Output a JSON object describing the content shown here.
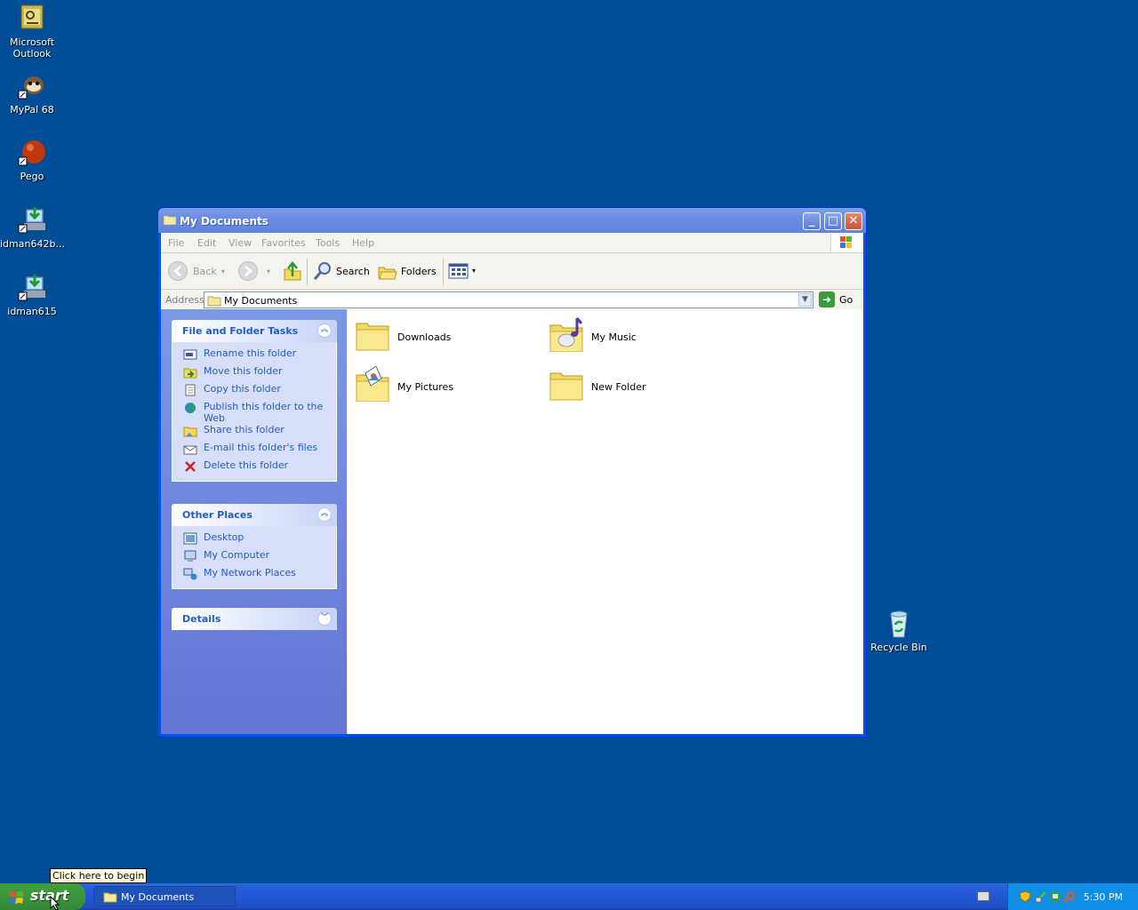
{
  "desktop": {
    "icons": [
      {
        "label": "Microsoft Outlook",
        "icon": "outlook-icon"
      },
      {
        "label": "MyPal 68",
        "icon": "mypal-icon"
      },
      {
        "label": "Pego",
        "icon": "pego-icon"
      },
      {
        "label": "idman642b...",
        "icon": "installer-icon"
      },
      {
        "label": "idman615",
        "icon": "installer-icon"
      },
      {
        "label": "Recycle Bin",
        "icon": "recycle-bin-icon"
      }
    ]
  },
  "window": {
    "title": "My Documents",
    "menu": [
      "File",
      "Edit",
      "View",
      "Favorites",
      "Tools",
      "Help"
    ],
    "toolbar": {
      "back": "Back",
      "search": "Search",
      "folders": "Folders"
    },
    "address": {
      "label": "Address",
      "value": "My Documents",
      "go": "Go"
    },
    "panels": {
      "file_tasks": {
        "title": "File and Folder Tasks",
        "items": [
          "Rename this folder",
          "Move this folder",
          "Copy this folder",
          "Publish this folder to the Web",
          "Share this folder",
          "E-mail this folder's files",
          "Delete this folder"
        ]
      },
      "other_places": {
        "title": "Other Places",
        "items": [
          "Desktop",
          "My Computer",
          "My Network Places"
        ]
      },
      "details": {
        "title": "Details"
      }
    },
    "folders": [
      "Downloads",
      "My Music",
      "My Pictures",
      "New Folder"
    ]
  },
  "taskbar": {
    "start": "start",
    "tooltip": "Click here to begin",
    "task_button": "My Documents",
    "clock": "5:30 PM"
  },
  "colors": {
    "desktop": "#004e98",
    "link": "#215dc6",
    "taskbar": "#245edb",
    "start": "#3f9b3d"
  }
}
